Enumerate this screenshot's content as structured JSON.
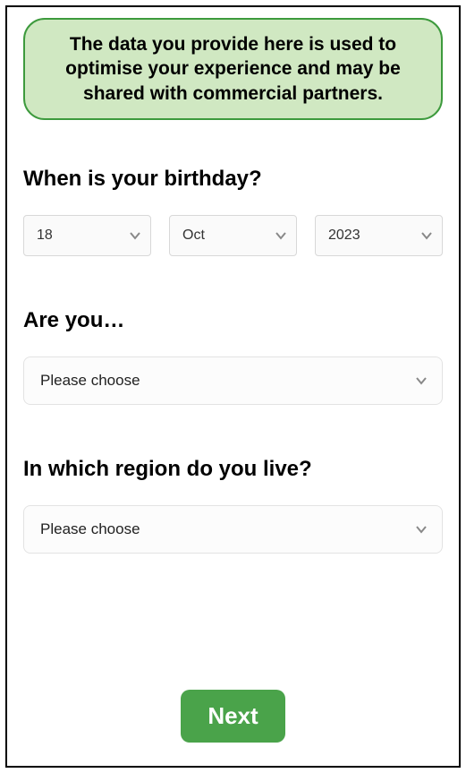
{
  "notice": "The data you provide here is used to optimise your experience and may be shared with commercial partners.",
  "sections": {
    "birthday": {
      "title": "When is your birthday?",
      "day": "18",
      "month": "Oct",
      "year": "2023"
    },
    "gender": {
      "title": "Are you…",
      "placeholder": "Please choose"
    },
    "region": {
      "title": "In which region do you live?",
      "placeholder": "Please choose"
    }
  },
  "buttons": {
    "next": "Next"
  }
}
